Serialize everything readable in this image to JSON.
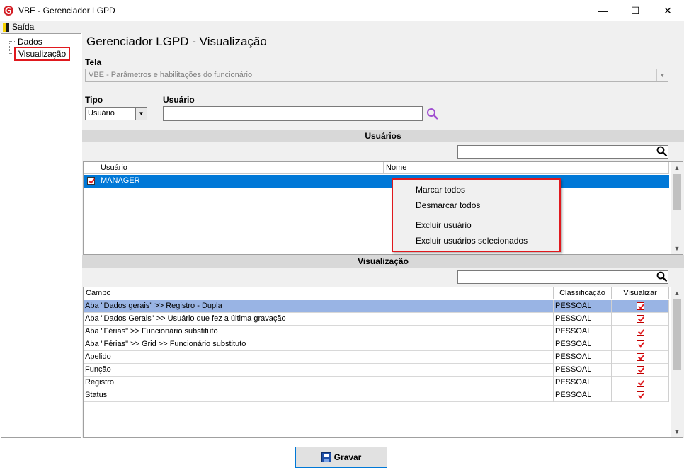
{
  "window": {
    "title": "VBE - Gerenciador LGPD",
    "minimize": "—",
    "maximize": "☐",
    "close": "✕"
  },
  "menu": {
    "exit_label": "Saída"
  },
  "tree": {
    "items": [
      "Dados",
      "Visualização"
    ]
  },
  "page": {
    "title": "Gerenciador LGPD - Visualização"
  },
  "tela": {
    "label": "Tela",
    "value": "VBE - Parâmetros e habilitações do funcionário"
  },
  "tipo": {
    "label": "Tipo",
    "value": "Usuário"
  },
  "usuario": {
    "label": "Usuário",
    "value": ""
  },
  "users_section": {
    "title": "Usuários",
    "columns": [
      "Usuário",
      "Nome"
    ],
    "rows": [
      {
        "usuario": "MANAGER",
        "nome": "",
        "checked": true
      }
    ]
  },
  "context_menu": {
    "items": [
      "Marcar todos",
      "Desmarcar todos",
      "Excluir usuário",
      "Excluir usuários selecionados"
    ]
  },
  "vis_section": {
    "title": "Visualização",
    "columns": [
      "Campo",
      "Classificação",
      "Visualizar"
    ],
    "rows": [
      {
        "campo": "Aba \"Dados gerais\" >> Registro - Dupla",
        "classificacao": "PESSOAL",
        "visualizar": true
      },
      {
        "campo": "Aba \"Dados Gerais\" >> Usuário que fez a última gravação",
        "classificacao": "PESSOAL",
        "visualizar": true
      },
      {
        "campo": "Aba \"Férias\" >> Funcionário substituto",
        "classificacao": "PESSOAL",
        "visualizar": true
      },
      {
        "campo": "Aba \"Férias\" >> Grid >> Funcionário substituto",
        "classificacao": "PESSOAL",
        "visualizar": true
      },
      {
        "campo": "Apelido",
        "classificacao": "PESSOAL",
        "visualizar": true
      },
      {
        "campo": "Função",
        "classificacao": "PESSOAL",
        "visualizar": true
      },
      {
        "campo": "Registro",
        "classificacao": "PESSOAL",
        "visualizar": true
      },
      {
        "campo": "Status",
        "classificacao": "PESSOAL",
        "visualizar": true
      }
    ]
  },
  "save_button": {
    "label": "Gravar"
  },
  "colors": {
    "accent": "#0078d7",
    "highlight": "#e0191e",
    "selected_row": "#99b4e4"
  }
}
